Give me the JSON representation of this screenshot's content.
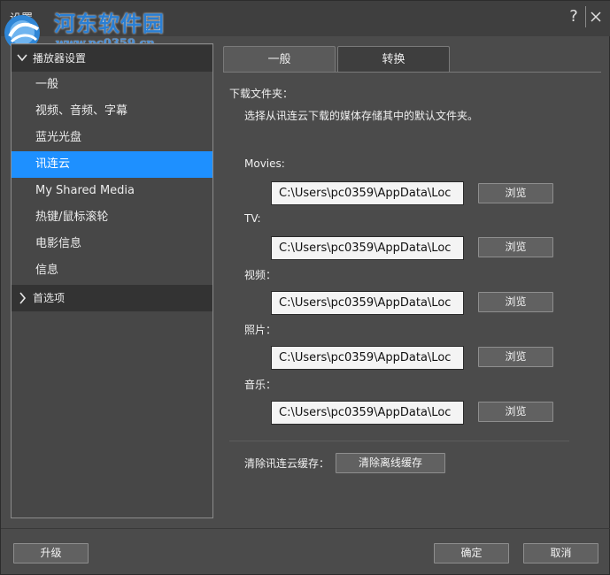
{
  "window": {
    "title": "设置",
    "watermark_text": "河东软件园",
    "watermark_url": "www.pc0359.cn"
  },
  "nav": {
    "groups": [
      {
        "label": "播放器设置",
        "expanded": true
      },
      {
        "label": "首选项",
        "expanded": false
      }
    ],
    "items": [
      {
        "label": "一般",
        "active": false
      },
      {
        "label": "视频、音频、字幕",
        "active": false
      },
      {
        "label": "蓝光光盘",
        "active": false
      },
      {
        "label": "讯连云",
        "active": true
      },
      {
        "label": "My Shared Media",
        "active": false
      },
      {
        "label": "热键/鼠标滚轮",
        "active": false
      },
      {
        "label": "电影信息",
        "active": false
      },
      {
        "label": "信息",
        "active": false
      }
    ]
  },
  "tabs": [
    {
      "label": "一般",
      "active": true
    },
    {
      "label": "转换",
      "active": false
    }
  ],
  "download": {
    "heading": "下载文件夹：",
    "description": "选择从讯连云下载的媒体存储其中的默认文件夹。",
    "browse_label": "浏览",
    "folders": [
      {
        "label": "Movies:",
        "path": "C:\\Users\\pc0359\\AppData\\Loc"
      },
      {
        "label": "TV:",
        "path": "C:\\Users\\pc0359\\AppData\\Loc"
      },
      {
        "label": "视频：",
        "path": "C:\\Users\\pc0359\\AppData\\Loc"
      },
      {
        "label": "照片：",
        "path": "C:\\Users\\pc0359\\AppData\\Loc"
      },
      {
        "label": "音乐：",
        "path": "C:\\Users\\pc0359\\AppData\\Loc"
      }
    ]
  },
  "cache": {
    "label": "清除讯连云缓存：",
    "button": "清除离线缓存"
  },
  "footer": {
    "upgrade": "升级",
    "ok": "确定",
    "cancel": "取消"
  },
  "colors": {
    "accent": "#1e90ff",
    "background": "#4b4b4b",
    "watermark": "#2a7fd4"
  }
}
